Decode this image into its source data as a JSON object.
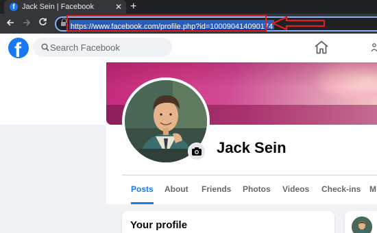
{
  "browser": {
    "tab_title": "Jack Sein | Facebook",
    "tab_favicon": "f",
    "tab_close": "✕",
    "new_tab": "+",
    "url": "https://www.facebook.com/profile.php?id=100090414090174"
  },
  "facebook": {
    "logo": "f",
    "search_placeholder": "Search Facebook"
  },
  "profile": {
    "name": "Jack Sein",
    "tabs": [
      {
        "label": "Posts",
        "active": true
      },
      {
        "label": "About"
      },
      {
        "label": "Friends"
      },
      {
        "label": "Photos"
      },
      {
        "label": "Videos"
      },
      {
        "label": "Check-ins"
      },
      {
        "label": "M"
      }
    ],
    "card_title": "Your profile"
  },
  "colors": {
    "facebook_blue": "#1877f2",
    "annotation_red": "#e02020",
    "url_selection": "#2a5bb8"
  },
  "icons": {
    "back": "arrow-left-icon",
    "forward": "arrow-right-icon",
    "reload": "reload-icon",
    "lock": "lock-icon",
    "search": "search-icon",
    "home": "home-icon",
    "camera": "camera-icon"
  }
}
